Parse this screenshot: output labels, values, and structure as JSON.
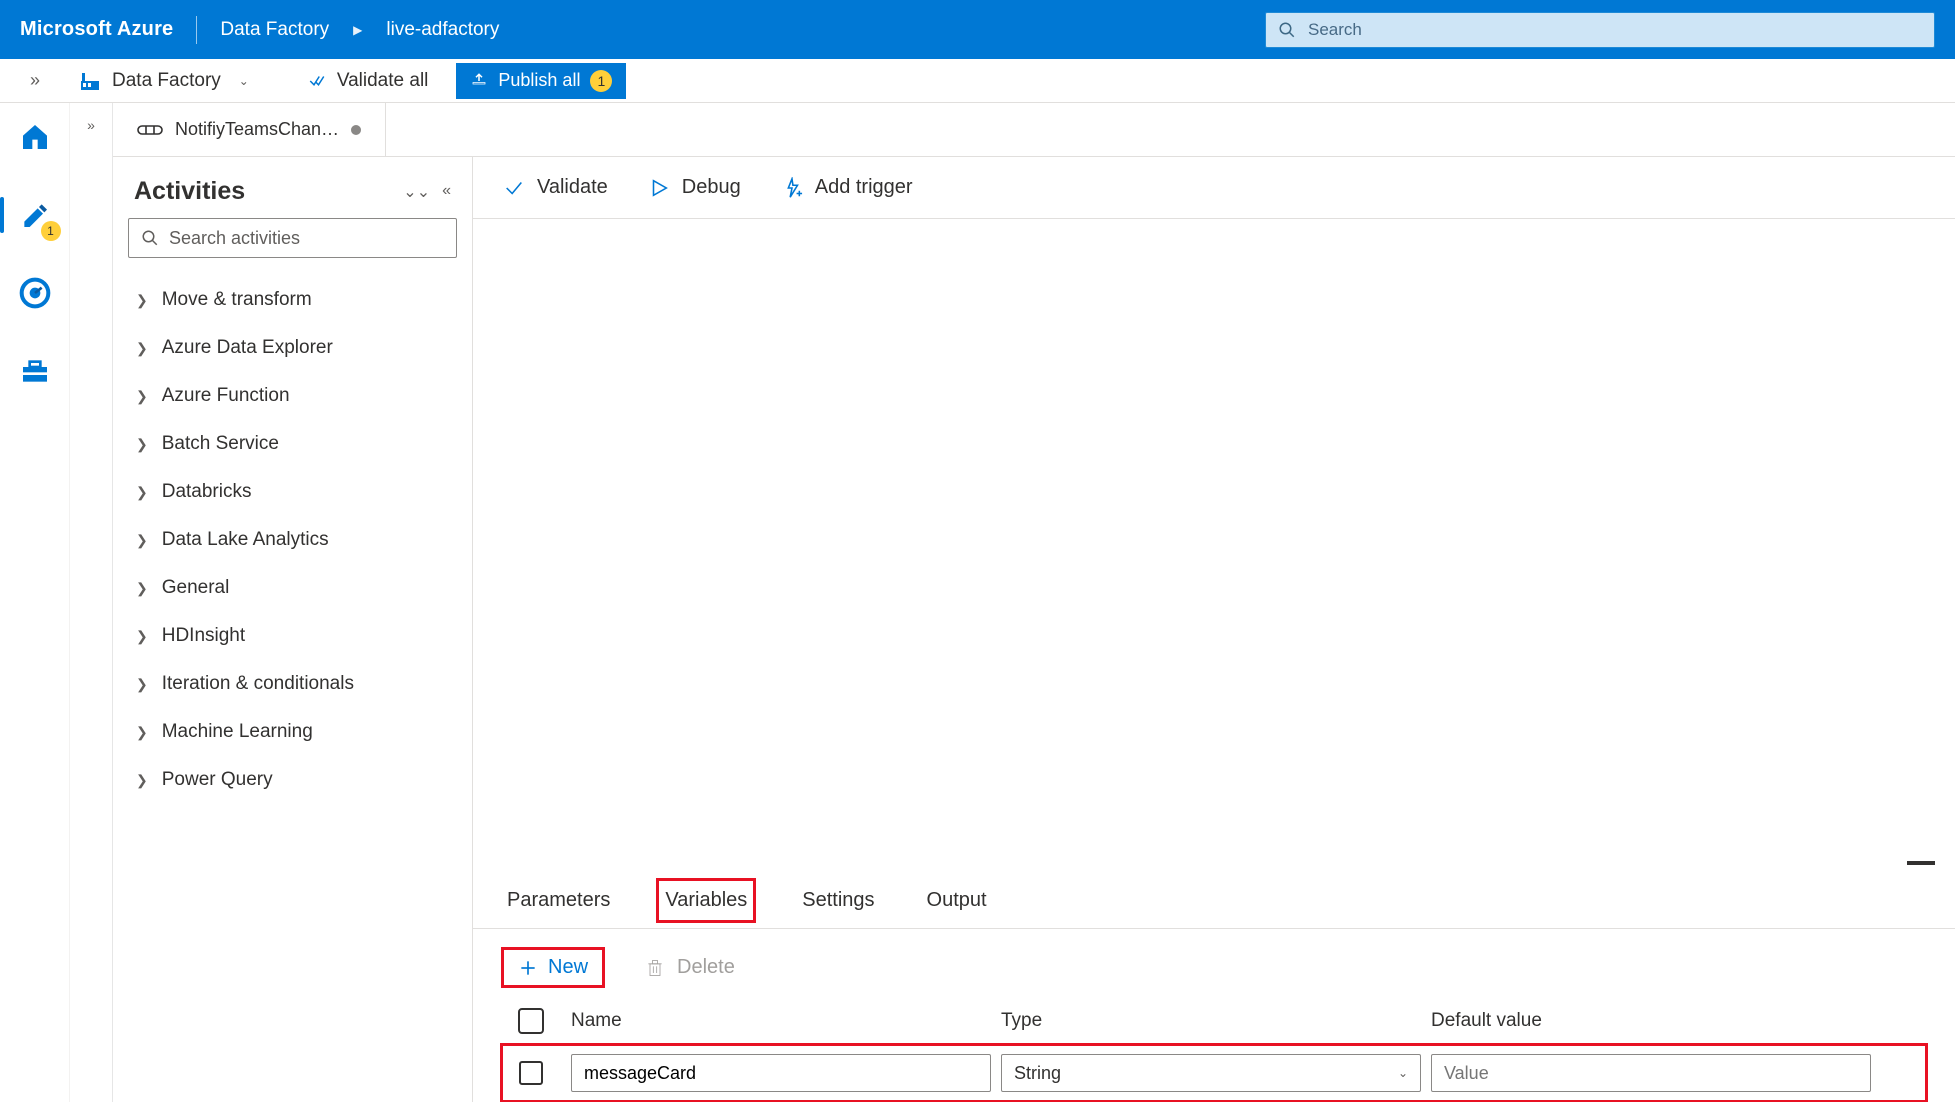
{
  "header": {
    "brand": "Microsoft Azure",
    "breadcrumb_root": "Data Factory",
    "breadcrumb_current": "live-adfactory",
    "search_placeholder": "Search"
  },
  "toolbar": {
    "data_factory_label": "Data Factory",
    "validate_all_label": "Validate all",
    "publish_all_label": "Publish all",
    "publish_count": "1"
  },
  "rail": {
    "pencil_badge": "1"
  },
  "pipeline_tab": {
    "name": "NotifiyTeamsChan…"
  },
  "activities": {
    "title": "Activities",
    "search_placeholder": "Search activities",
    "items": [
      "Move & transform",
      "Azure Data Explorer",
      "Azure Function",
      "Batch Service",
      "Databricks",
      "Data Lake Analytics",
      "General",
      "HDInsight",
      "Iteration & conditionals",
      "Machine Learning",
      "Power Query"
    ]
  },
  "canvas_toolbar": {
    "validate": "Validate",
    "debug": "Debug",
    "add_trigger": "Add trigger"
  },
  "bottom_tabs": {
    "parameters": "Parameters",
    "variables": "Variables",
    "settings": "Settings",
    "output": "Output"
  },
  "vartools": {
    "new": "New",
    "delete": "Delete"
  },
  "vartable": {
    "col_name": "Name",
    "col_type": "Type",
    "col_default": "Default value",
    "rows": [
      {
        "name": "messageCard",
        "type": "String",
        "default_placeholder": "Value"
      }
    ]
  }
}
